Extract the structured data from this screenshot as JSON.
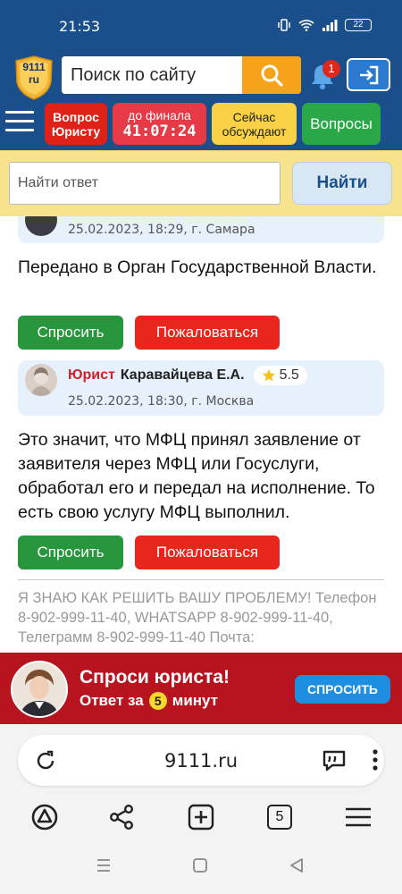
{
  "status_bar": {
    "time": "21:53",
    "battery": "22"
  },
  "header": {
    "logo_text": [
      "9111",
      "ru"
    ],
    "search_placeholder": "Поиск по сайту",
    "notification_count": "1"
  },
  "nav_pills": {
    "ask_lawyer": [
      "Вопрос",
      "Юристу"
    ],
    "to_final_label": "до финала",
    "to_final_timer": "41:07:24",
    "discussing": [
      "Сейчас",
      "обсуждают"
    ],
    "questions": "Вопросы"
  },
  "find_bar": {
    "placeholder": "Найти ответ",
    "button": "Найти"
  },
  "answers": [
    {
      "meta": "25.02.2023, 18:29,  г. Самара",
      "text": "Передано в Орган Государственной Власти.",
      "ask_label": "Спросить",
      "report_label": "Пожаловаться"
    },
    {
      "role": "Юрист",
      "name": "Каравайцева Е.А.",
      "rating": "5.5",
      "meta": "25.02.2023, 18:30,  г. Москва",
      "text": "Это значит, что МФЦ принял заявление от заявителя через МФЦ или Госуслуги, обработал его и передал на исполнение. То есть свою услугу МФЦ выполнил.",
      "ask_label": "Спросить",
      "report_label": "Пожаловаться"
    }
  ],
  "promo": "Я ЗНАЮ КАК РЕШИТЬ ВАШУ ПРОБЛЕМУ! Телефон 8-902-999-11-40, WHATSAPP 8-902-999-11-40, Телеграмм 8-902-999-11-40 Почта:",
  "banner": {
    "title": "Спроси юриста!",
    "sub_before": "Ответ за",
    "sub_number": "5",
    "sub_after": "минут",
    "button": "СПРОСИТЬ"
  },
  "browser": {
    "url": "9111.ru",
    "tabs_count": "5"
  },
  "colors": {
    "header_blue": "#1a4f8b",
    "accent_orange": "#f6a21a",
    "ask_green": "#27963c",
    "report_red": "#e8261b",
    "banner_red": "#b8141f"
  }
}
